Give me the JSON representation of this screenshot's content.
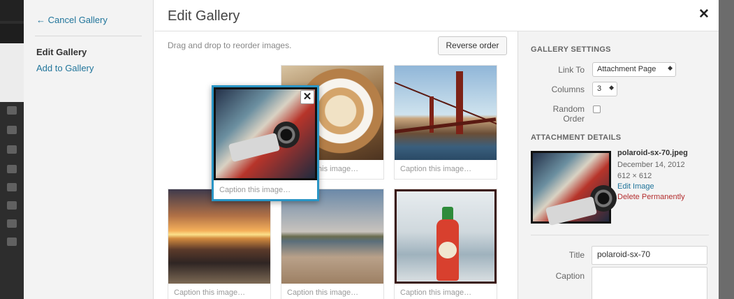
{
  "menu": {
    "cancel_label": "← Cancel Gallery",
    "current_label": "Edit Gallery",
    "add_label": "Add to Gallery"
  },
  "header": {
    "title": "Edit Gallery",
    "close_glyph": "✕"
  },
  "toolbar": {
    "hint": "Drag and drop to reorder images.",
    "reverse_label": "Reverse order"
  },
  "gallery": {
    "caption_placeholder": "Caption this image…",
    "items": [
      {
        "image": "coffee-latte",
        "caption": "Caption this image…"
      },
      {
        "image": "golden-gate-bridge",
        "caption": "Caption this image…"
      },
      {
        "image": "sunset-beach",
        "caption": "Caption this image…"
      },
      {
        "image": "coastline-beach",
        "caption": "Caption this image…"
      },
      {
        "image": "sriracha-fridge",
        "caption": "Caption this image…"
      }
    ],
    "dragged": {
      "image": "polaroid-camera",
      "caption": "Caption this image…",
      "remove_glyph": "✕"
    }
  },
  "settings": {
    "heading": "GALLERY SETTINGS",
    "link_to_label": "Link To",
    "link_to_value": "Attachment Page",
    "columns_label": "Columns",
    "columns_value": "3",
    "random_label": "Random Order",
    "random_checked": false
  },
  "attachment": {
    "heading": "ATTACHMENT DETAILS",
    "filename": "polaroid-sx-70.jpeg",
    "date": "December 14, 2012",
    "dimensions": "612 × 612",
    "edit_label": "Edit Image",
    "delete_label": "Delete Permanently",
    "title_label": "Title",
    "title_value": "polaroid-sx-70",
    "caption_label": "Caption",
    "caption_value": ""
  },
  "colors": {
    "link": "#21759b",
    "accent": "#2a95c5",
    "danger": "#b32d2e"
  }
}
